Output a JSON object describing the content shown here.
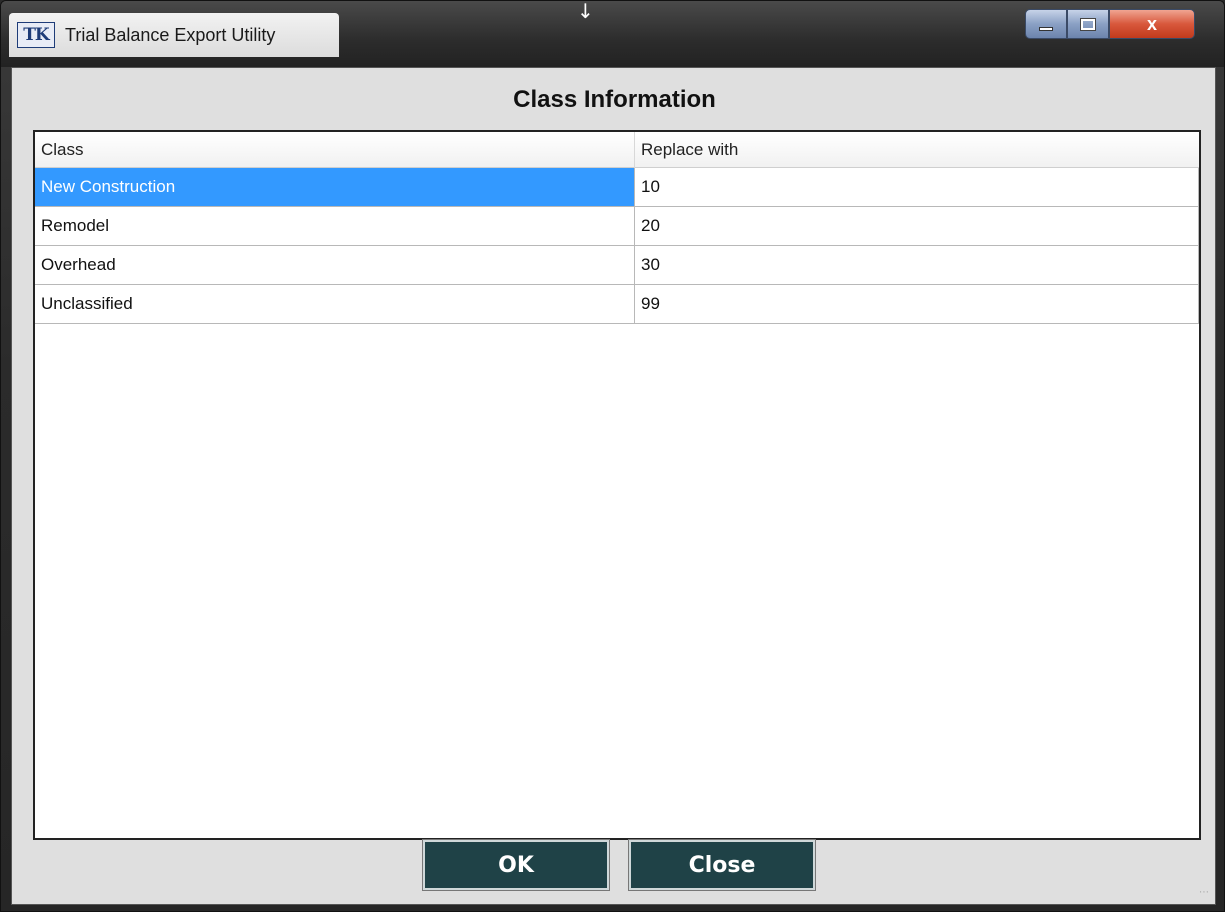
{
  "window": {
    "title": "Trial Balance Export Utility",
    "logo_text": "TK",
    "close_glyph": "x"
  },
  "dialog": {
    "title": "Class Information"
  },
  "grid": {
    "columns": [
      "Class",
      "Replace with"
    ],
    "rows": [
      {
        "class": "New Construction",
        "replace_with": "10",
        "selected": true
      },
      {
        "class": "Remodel",
        "replace_with": "20"
      },
      {
        "class": "Overhead",
        "replace_with": "30"
      },
      {
        "class": "Unclassified",
        "replace_with": "99"
      }
    ]
  },
  "buttons": {
    "ok_label": "OK",
    "close_label": "Close"
  },
  "colors": {
    "selection": "#3399ff",
    "button_bg": "#1f4247",
    "close_control": "#d8583c"
  }
}
